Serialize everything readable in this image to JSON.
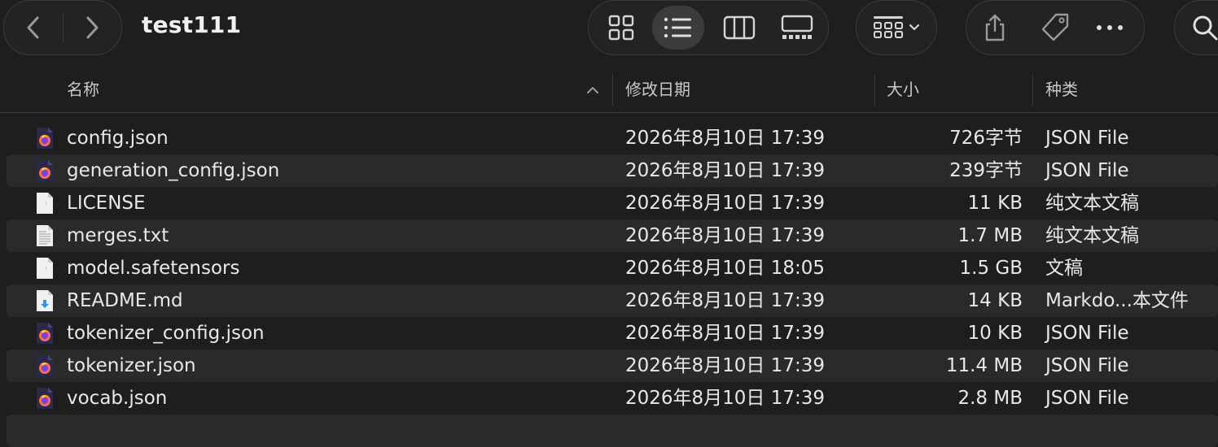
{
  "window": {
    "title": "test111"
  },
  "toolbar": {
    "back_icon": "chevron-left-icon",
    "forward_icon": "chevron-right-icon",
    "views": [
      "icon-view-icon",
      "list-view-icon",
      "column-view-icon",
      "gallery-view-icon"
    ],
    "active_view": "list-view-icon",
    "group_icon": "group-by-icon",
    "actions": [
      "share-icon",
      "tag-icon",
      "more-icon"
    ],
    "search_icon": "search-icon"
  },
  "columns": {
    "name": "名称",
    "date": "修改日期",
    "size": "大小",
    "kind": "种类",
    "sort_icon": "chevron-up-icon"
  },
  "files": [
    {
      "name": "config.json",
      "date": "2026年8月10日 17:39",
      "size": "726字节",
      "kind": "JSON File",
      "icon": "firefox-json-icon"
    },
    {
      "name": "generation_config.json",
      "date": "2026年8月10日 17:39",
      "size": "239字节",
      "kind": "JSON File",
      "icon": "firefox-json-icon"
    },
    {
      "name": "LICENSE",
      "date": "2026年8月10日 17:39",
      "size": "11 KB",
      "kind": "纯文本文稿",
      "icon": "blank-document-icon"
    },
    {
      "name": "merges.txt",
      "date": "2026年8月10日 17:39",
      "size": "1.7 MB",
      "kind": "纯文本文稿",
      "icon": "text-document-icon"
    },
    {
      "name": "model.safetensors",
      "date": "2026年8月10日 18:05",
      "size": "1.5 GB",
      "kind": "文稿",
      "icon": "blank-document-icon"
    },
    {
      "name": "README.md",
      "date": "2026年8月10日 17:39",
      "size": "14 KB",
      "kind": "Markdo...本文件",
      "icon": "markdown-document-icon"
    },
    {
      "name": "tokenizer_config.json",
      "date": "2026年8月10日 17:39",
      "size": "10 KB",
      "kind": "JSON File",
      "icon": "firefox-json-icon"
    },
    {
      "name": "tokenizer.json",
      "date": "2026年8月10日 17:39",
      "size": "11.4 MB",
      "kind": "JSON File",
      "icon": "firefox-json-icon"
    },
    {
      "name": "vocab.json",
      "date": "2026年8月10日 17:39",
      "size": "2.8 MB",
      "kind": "JSON File",
      "icon": "firefox-json-icon"
    }
  ],
  "colors": {
    "background": "#1e1e1e",
    "row_alt": "#2a2a2a",
    "text": "#e8e8e8",
    "secondary_text": "#c8c8c8",
    "icon": "#d0d0d0"
  }
}
